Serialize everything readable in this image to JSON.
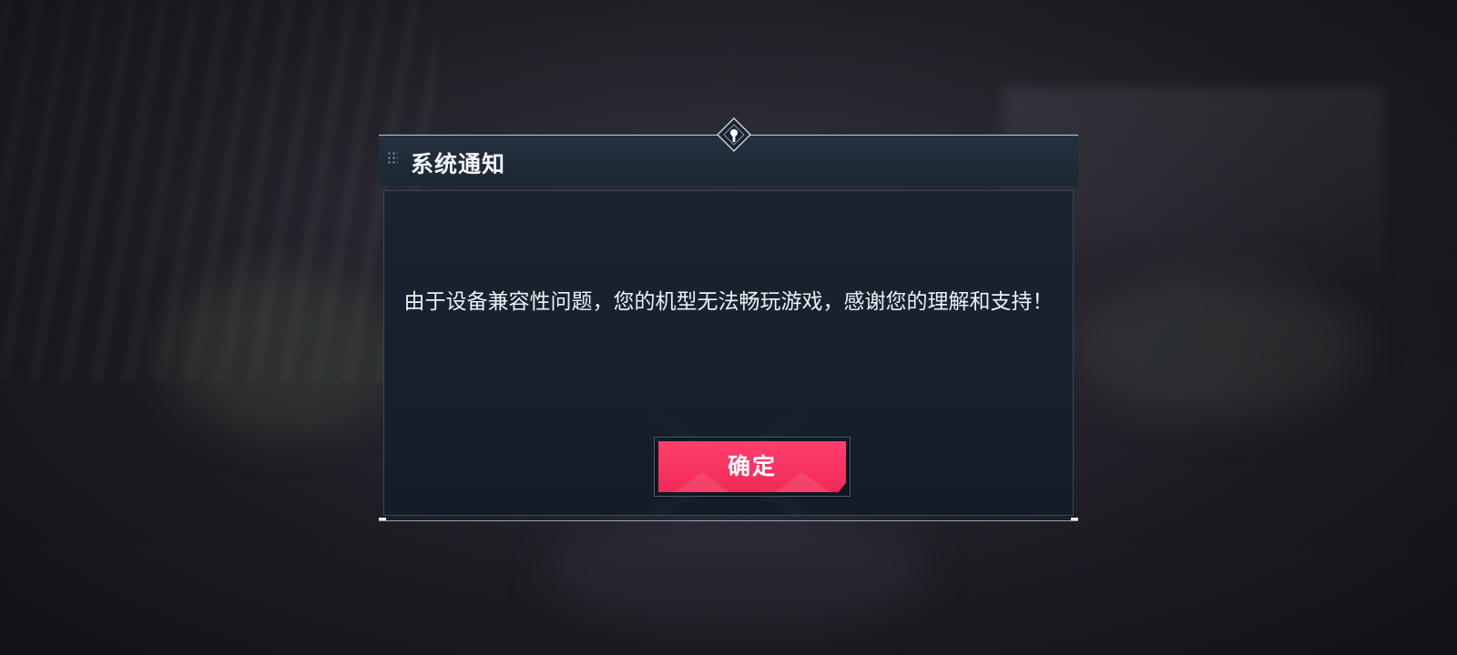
{
  "dialog": {
    "title": "系统通知",
    "message": "由于设备兼容性问题，您的机型无法畅玩游戏，感谢您的理解和支持！",
    "confirm_label": "确定"
  },
  "colors": {
    "header_bg": "#1f2a37",
    "body_bg": "#17202b",
    "confirm_button": "#f5305e",
    "text": "#eef1f5"
  },
  "icons": {
    "header_grip": "drag-grip-icon",
    "top_ornament": "diamond-ornament-icon"
  }
}
